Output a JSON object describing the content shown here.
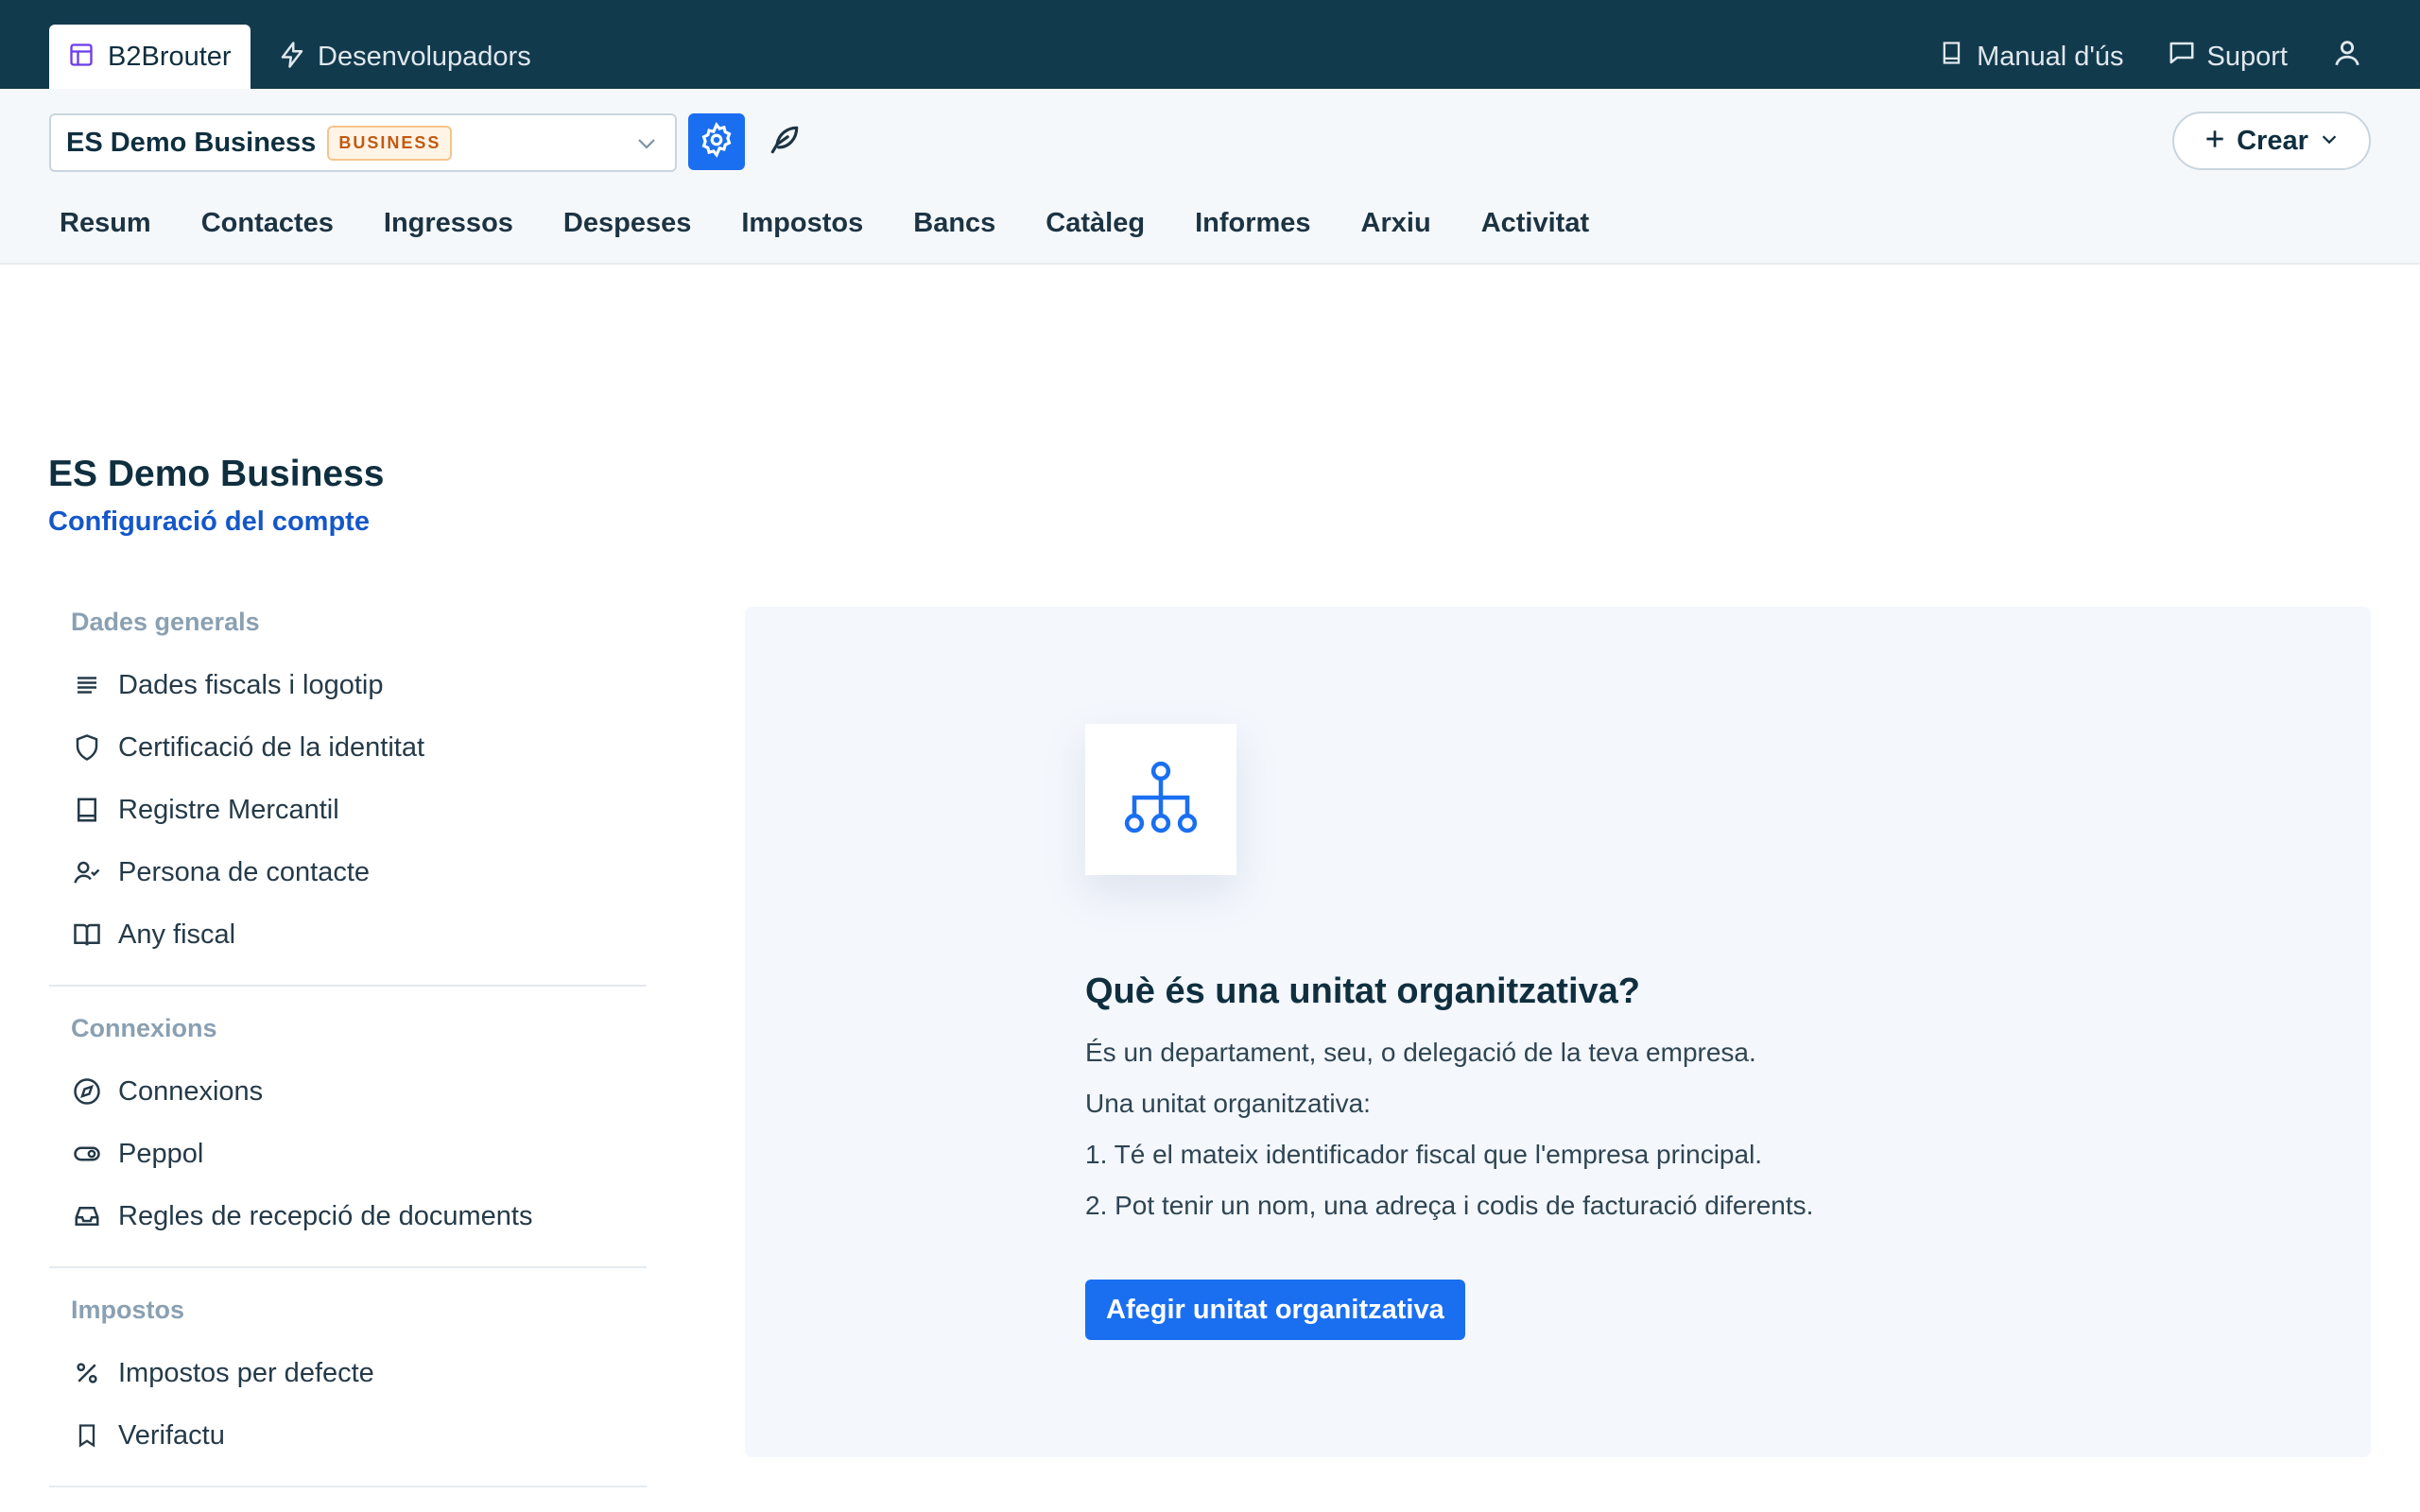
{
  "topbar": {
    "app_tab": "B2Brouter",
    "dev_tab": "Desenvolupadors",
    "manual": "Manual d'ús",
    "support": "Suport"
  },
  "subbar": {
    "company": "ES Demo Business",
    "badge": "BUSINESS",
    "create": "Crear",
    "nav": [
      "Resum",
      "Contactes",
      "Ingressos",
      "Despeses",
      "Impostos",
      "Bancs",
      "Catàleg",
      "Informes",
      "Arxiu",
      "Activitat"
    ]
  },
  "page": {
    "title": "ES Demo Business",
    "subtitle": "Configuració del compte"
  },
  "sidebar": {
    "sections": [
      {
        "title": "Dades generals",
        "items": [
          {
            "label": "Dades fiscals i logotip",
            "icon": "text-lines-icon"
          },
          {
            "label": "Certificació de la identitat",
            "icon": "shield-icon"
          },
          {
            "label": "Registre Mercantil",
            "icon": "book-icon"
          },
          {
            "label": "Persona de contacte",
            "icon": "user-check-icon"
          },
          {
            "label": "Any fiscal",
            "icon": "open-book-icon"
          }
        ]
      },
      {
        "title": "Connexions",
        "items": [
          {
            "label": "Connexions",
            "icon": "compass-icon"
          },
          {
            "label": "Peppol",
            "icon": "toggle-icon"
          },
          {
            "label": "Regles de recepció de documents",
            "icon": "inbox-icon"
          }
        ]
      },
      {
        "title": "Impostos",
        "items": [
          {
            "label": "Impostos per defecte",
            "icon": "percent-icon"
          },
          {
            "label": "Verifactu",
            "icon": "bookmark-icon"
          }
        ]
      }
    ]
  },
  "panel": {
    "title": "Què és una unitat organitzativa?",
    "line1": "És un departament, seu, o delegació de la teva empresa.",
    "line2": "Una unitat organitzativa:",
    "line3": "1. Té el mateix identificador fiscal que l'empresa principal.",
    "line4": "2. Pot tenir un nom, una adreça i codis de facturació diferents.",
    "button": "Afegir unitat organitzativa"
  },
  "colors": {
    "topbar": "#123a4d",
    "accent": "#1a6ff1",
    "link": "#1457c9",
    "badge_text": "#c25a12"
  }
}
